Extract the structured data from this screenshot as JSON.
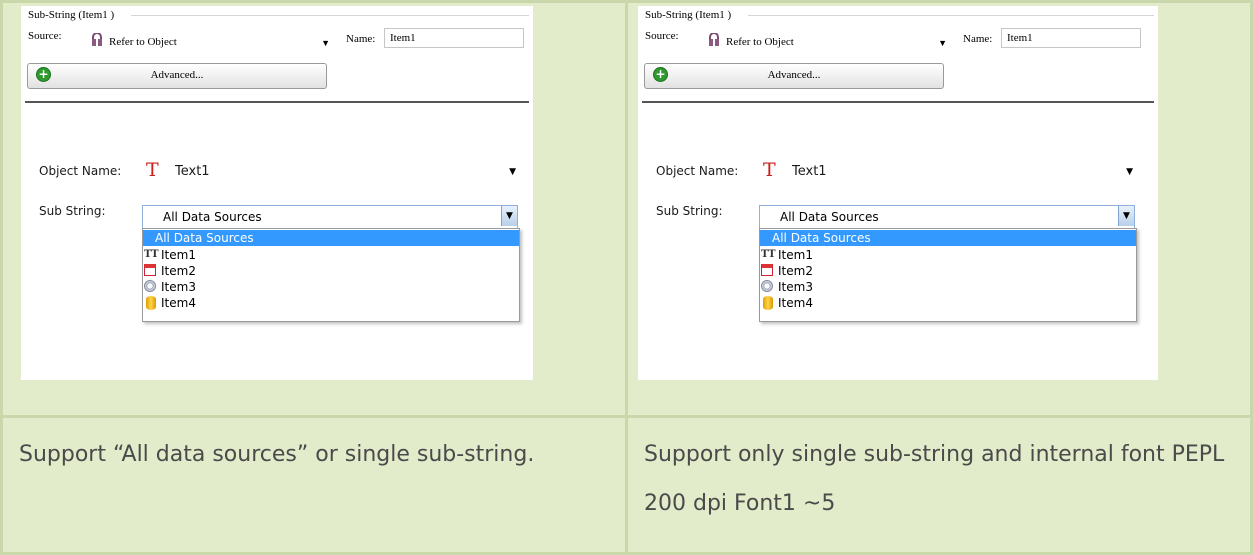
{
  "panels": [
    {
      "group_title": "Sub-String (Item1 )",
      "source_label": "Source:",
      "source_value": "Refer to Object",
      "name_label": "Name:",
      "name_value": "Item1",
      "advanced_label": "Advanced...",
      "object_name_label": "Object Name:",
      "object_name_value": "Text1",
      "sub_string_label": "Sub String:",
      "sub_string_value": "All Data Sources",
      "dropdown": {
        "selected": "All Data Sources",
        "items": [
          "Item1",
          "Item2",
          "Item3",
          "Item4"
        ]
      }
    },
    {
      "group_title": "Sub-String (Item1 )",
      "source_label": "Source:",
      "source_value": "Refer to Object",
      "name_label": "Name:",
      "name_value": "Item1",
      "advanced_label": "Advanced...",
      "object_name_label": "Object Name:",
      "object_name_value": "Text1",
      "sub_string_label": "Sub String:",
      "sub_string_value": "All Data Sources",
      "dropdown": {
        "selected": "All Data Sources",
        "items": [
          "Item1",
          "Item2",
          "Item3",
          "Item4"
        ]
      }
    }
  ],
  "captions": {
    "left": "Support “All data sources” or single sub-string.",
    "right": "Support only single sub-string and internal font PEPL 200 dpi Font1 ~5"
  },
  "icons": [
    "object-source-icon",
    "add-icon",
    "text-object-icon",
    "dropdown-arrow-icon",
    "text-item-icon",
    "date-item-icon",
    "time-item-icon",
    "database-item-icon"
  ],
  "colors": {
    "table_bg": "#e2eccb",
    "selection": "#3399ff",
    "text_icon": "#cc1e1e"
  }
}
